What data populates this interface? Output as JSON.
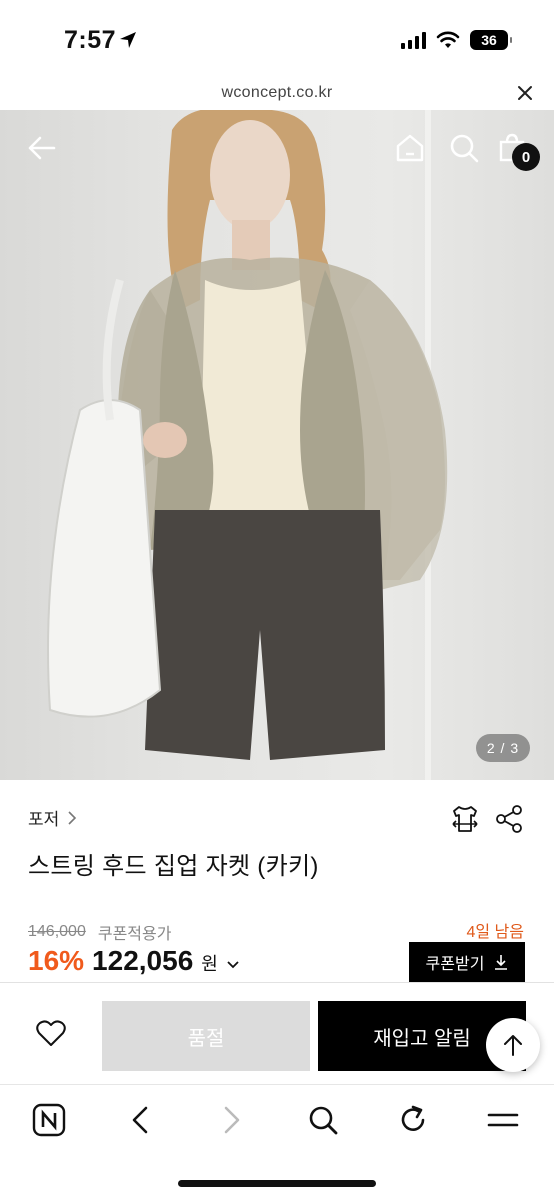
{
  "status_bar": {
    "time": "7:57",
    "battery": "36"
  },
  "url_bar": {
    "domain": "wconcept.co.kr"
  },
  "hero": {
    "page_indicator": "2 / 3",
    "cart_count": "0"
  },
  "product": {
    "breadcrumb": "포저",
    "title": "스트링 후드 집업 자켓 (카키)",
    "original_price": "146,000",
    "coupon_price_label": "쿠폰적용가",
    "days_left": "4일 남음",
    "discount": "16%",
    "price": "122,056",
    "currency": "원",
    "coupon_button": "쿠폰받기"
  },
  "actions": {
    "soldout_label": "품절",
    "restock_label": "재입고 알림"
  },
  "colors": {
    "accent": "#f05a1c",
    "days_left": "#e05a1b",
    "primary_button": "#000000",
    "disabled_button": "#dcdcdc"
  },
  "icons": {
    "hero": [
      "back-arrow-icon",
      "home-icon",
      "search-icon",
      "shopping-bag-icon"
    ],
    "tools": [
      "size-guide-icon",
      "share-icon"
    ],
    "toolbar": [
      "naver-home-icon",
      "back-icon",
      "forward-icon",
      "search-icon",
      "refresh-icon",
      "menu-icon"
    ]
  }
}
